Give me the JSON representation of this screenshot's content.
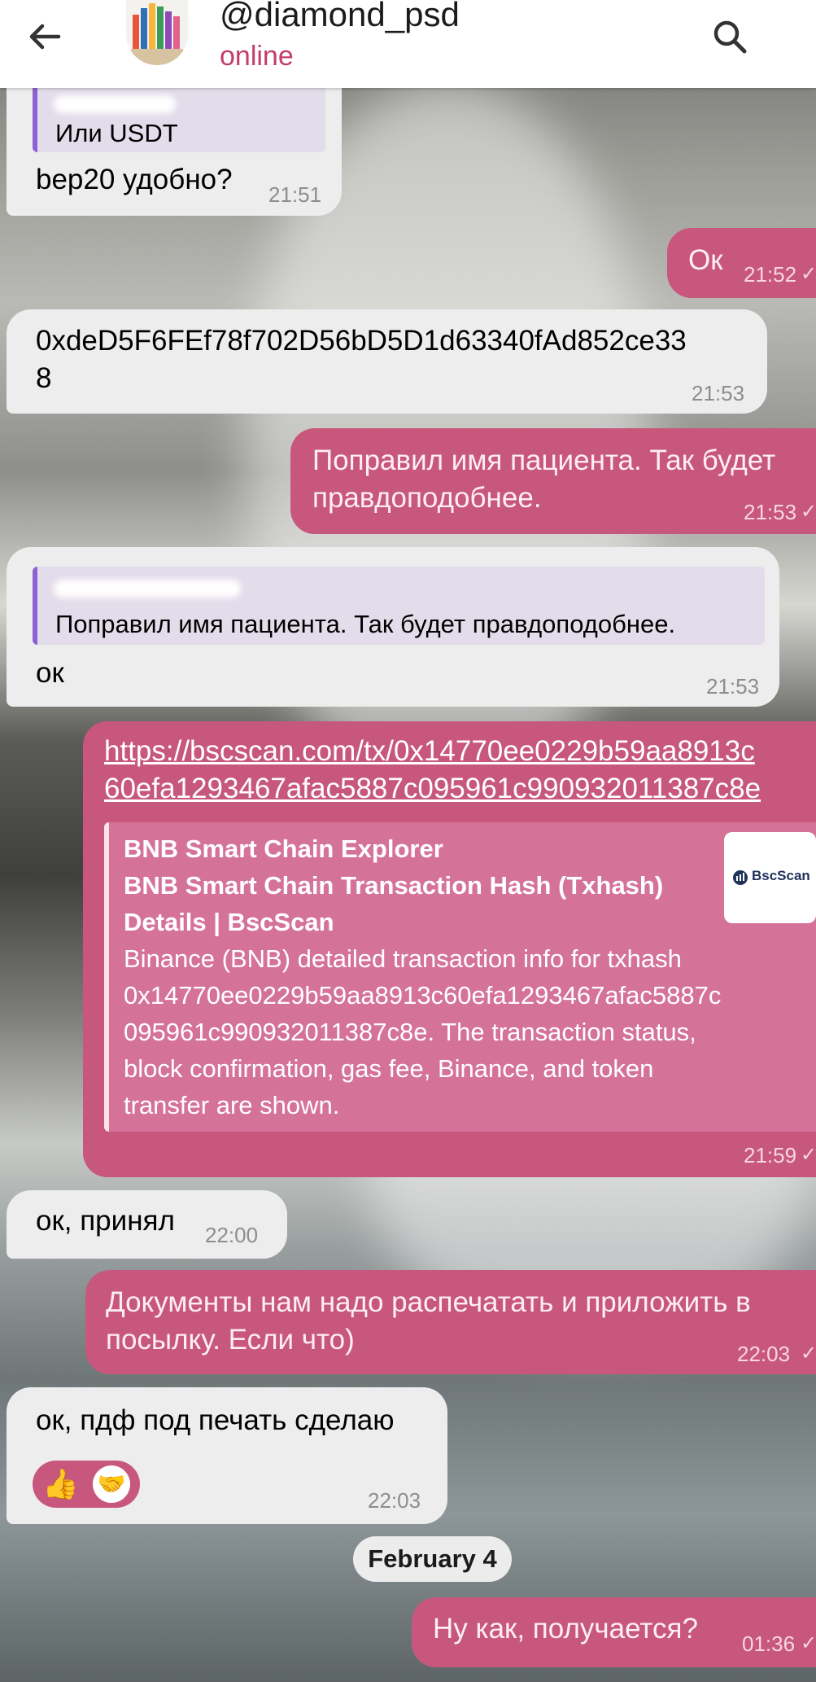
{
  "header": {
    "title": "@diamond_psd",
    "status": "online"
  },
  "messages": {
    "m1": {
      "quote_text": "Или USDT",
      "text": "bep20 удобно?",
      "time": "21:51"
    },
    "m2": {
      "text": "Ок",
      "time": "21:52"
    },
    "m3": {
      "line1": "0xdeD5F6FEf78f702D56bD5D1d63340fAd852ce33",
      "line2": "8",
      "time": "21:53"
    },
    "m4": {
      "line1": "Поправил имя пациента. Так будет",
      "line2": "правдоподобнее.",
      "time": "21:53"
    },
    "m5": {
      "quote_text": "Поправил имя пациента. Так будет правдоподобнее.",
      "text": "ок",
      "time": "21:53"
    },
    "m6": {
      "link1": "https://bscscan.com/tx/0x14770ee0229b59aa8913c",
      "link2": "60efa1293467afac5887c095961c990932011387c8e",
      "preview_site": "BNB Smart Chain Explorer",
      "preview_title1": "BNB Smart Chain Transaction Hash (Txhash)",
      "preview_title2": "Details | BscScan",
      "preview_desc": [
        "Binance (BNB) detailed transaction info for txhash",
        "0x14770ee0229b59aa8913c60efa1293467afac5887c",
        "095961c990932011387c8e. The transaction status,",
        "block confirmation, gas fee, Binance, and token",
        "transfer are shown."
      ],
      "thumb_label": "BscScan",
      "time": "21:59"
    },
    "m7": {
      "text": "ок, принял",
      "time": "22:00"
    },
    "m8": {
      "line1": "Документы нам надо распечатать и приложить в",
      "line2": "посылку. Если что)",
      "time": "22:03"
    },
    "m9": {
      "text": "ок, пдф под печать сделаю",
      "time": "22:03"
    },
    "date_divider": "February 4",
    "m10": {
      "text": "Ну как, получается?",
      "time": "01:36"
    }
  },
  "icons": {
    "back": "arrow-left-icon",
    "search": "search-icon",
    "read_check": "check-icon",
    "reaction_1": "thumbs-up-icon",
    "reaction_2": "handshake-icon"
  },
  "colors": {
    "outgoing_bubble": "#c8577e",
    "incoming_bubble": "#ededee",
    "accent_status": "#c33d6a",
    "quote_bar": "#8b62d1"
  }
}
